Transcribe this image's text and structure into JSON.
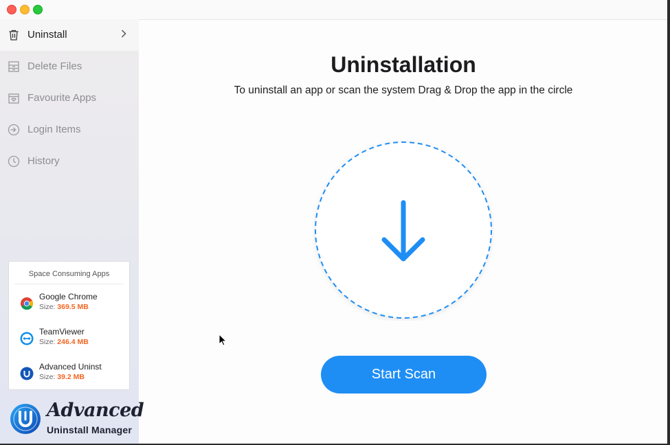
{
  "sidebar": {
    "items": [
      {
        "label": "Uninstall",
        "icon": "trash-icon",
        "active": true
      },
      {
        "label": "Delete Files",
        "icon": "archive-box-icon",
        "active": false
      },
      {
        "label": "Favourite Apps",
        "icon": "favourite-box-icon",
        "active": false
      },
      {
        "label": "Login Items",
        "icon": "login-arrow-icon",
        "active": false
      },
      {
        "label": "History",
        "icon": "clock-icon",
        "active": false
      }
    ],
    "space_card": {
      "title": "Space Consuming Apps",
      "size_prefix": "Size:",
      "apps": [
        {
          "name": "Google Chrome",
          "size": "369.5 MB",
          "icon": "chrome-icon"
        },
        {
          "name": "TeamViewer",
          "size": "246.4 MB",
          "icon": "teamviewer-icon"
        },
        {
          "name": "Advanced Uninst",
          "size": "39.2 MB",
          "icon": "advanced-uninstall-icon"
        }
      ]
    },
    "brand": {
      "script": "Advanced",
      "sub": "Uninstall Manager"
    }
  },
  "main": {
    "title": "Uninstallation",
    "subtitle": "To uninstall an app or scan the system Drag & Drop the app in the circle",
    "drop_icon": "download-arrow-icon",
    "button_label": "Start Scan"
  },
  "colors": {
    "accent": "#1e8ef5",
    "size_value": "#f26522"
  }
}
